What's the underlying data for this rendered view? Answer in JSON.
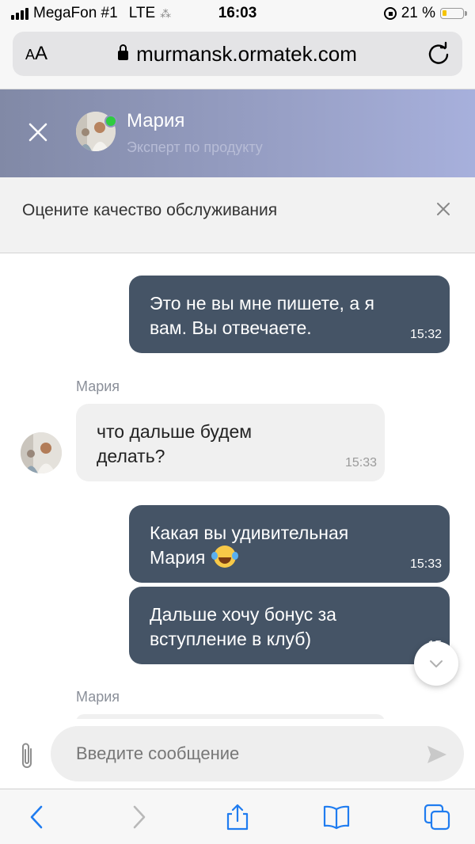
{
  "status_bar": {
    "carrier": "MegaFon #1",
    "network": "LTE",
    "time": "16:03",
    "battery_percent": "21 %",
    "battery_level": 0.21
  },
  "browser": {
    "aa_label_small": "A",
    "aa_label_large": "A",
    "url": "murmansk.ormatek.com"
  },
  "chat_header": {
    "agent_name": "Мария",
    "agent_role": "Эксперт по продукту",
    "online": true
  },
  "rating_banner": {
    "text": "Оцените качество обслуживания"
  },
  "messages": [
    {
      "direction": "out",
      "lines": [
        "Это не вы мне пишете, а я",
        "вам. Вы отвечаете."
      ],
      "time": "15:32"
    },
    {
      "direction": "in",
      "sender": "Мария",
      "lines": [
        "что дальше будем",
        "делать?"
      ],
      "time": "15:33"
    },
    {
      "direction": "out",
      "lines": [
        "Какая вы удивительная",
        "Мария"
      ],
      "emoji": "face-with-tears-of-joy",
      "time": "15:33"
    },
    {
      "direction": "out",
      "lines": [
        "Дальше хочу бонус за",
        "вступление в клуб)"
      ],
      "time": "15"
    },
    {
      "direction": "in",
      "sender": "Мария",
      "lines": [],
      "time": ""
    }
  ],
  "input": {
    "placeholder": "Введите сообщение"
  },
  "icons": {
    "attach": "paperclip-icon",
    "send": "send-icon",
    "scroll_down": "chevron-down-icon"
  },
  "colors": {
    "outgoing_bubble": "#455466",
    "incoming_bubble": "#f0f0f0",
    "header_gradient_start": "#8189a6",
    "header_gradient_end": "#a7b0dc",
    "online_dot": "#2ecc40",
    "battery_fill": "#f5c400"
  }
}
